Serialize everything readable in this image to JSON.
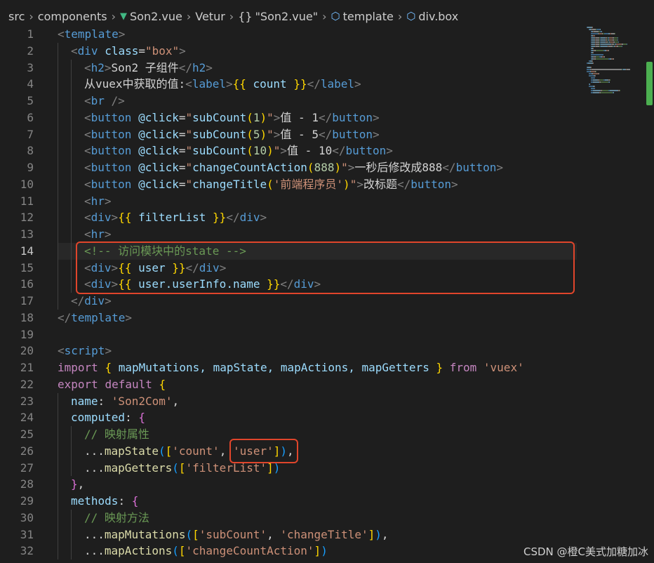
{
  "breadcrumb": {
    "items": [
      {
        "label": "src",
        "icon": ""
      },
      {
        "label": "components",
        "icon": ""
      },
      {
        "label": "Son2.vue",
        "icon": "vue-icon"
      },
      {
        "label": "Vetur",
        "icon": ""
      },
      {
        "label": "\"Son2.vue\"",
        "icon": "braces-icon"
      },
      {
        "label": "template",
        "icon": "cube-icon"
      },
      {
        "label": "div.box",
        "icon": "cube-icon"
      }
    ]
  },
  "editor": {
    "active_line": 14,
    "lines": [
      {
        "n": "1",
        "indent": 0,
        "tokens": [
          [
            "<",
            "t-punc"
          ],
          [
            "template",
            "t-tag"
          ],
          [
            ">",
            "t-punc"
          ]
        ]
      },
      {
        "n": "2",
        "indent": 1,
        "tokens": [
          [
            "<",
            "t-punc"
          ],
          [
            "div",
            "t-tag"
          ],
          [
            " ",
            "t-text"
          ],
          [
            "class",
            "t-attr"
          ],
          [
            "=",
            "t-text"
          ],
          [
            "\"box\"",
            "t-str"
          ],
          [
            ">",
            "t-punc"
          ]
        ]
      },
      {
        "n": "3",
        "indent": 2,
        "tokens": [
          [
            "<",
            "t-punc"
          ],
          [
            "h2",
            "t-tag"
          ],
          [
            ">",
            "t-punc"
          ],
          [
            "Son2 子组件",
            "t-text"
          ],
          [
            "</",
            "t-punc"
          ],
          [
            "h2",
            "t-tag"
          ],
          [
            ">",
            "t-punc"
          ]
        ]
      },
      {
        "n": "4",
        "indent": 2,
        "tokens": [
          [
            "从vuex中获取的值:",
            "t-text"
          ],
          [
            "<",
            "t-punc"
          ],
          [
            "label",
            "t-tag"
          ],
          [
            ">",
            "t-punc"
          ],
          [
            "{{",
            "t-brace"
          ],
          [
            " count ",
            "t-var"
          ],
          [
            "}}",
            "t-brace"
          ],
          [
            "</",
            "t-punc"
          ],
          [
            "label",
            "t-tag"
          ],
          [
            ">",
            "t-punc"
          ]
        ]
      },
      {
        "n": "5",
        "indent": 2,
        "tokens": [
          [
            "<",
            "t-punc"
          ],
          [
            "br",
            "t-tag"
          ],
          [
            " />",
            "t-punc"
          ]
        ]
      },
      {
        "n": "6",
        "indent": 2,
        "tokens": [
          [
            "<",
            "t-punc"
          ],
          [
            "button",
            "t-tag"
          ],
          [
            " ",
            "t-text"
          ],
          [
            "@click",
            "t-attr"
          ],
          [
            "=",
            "t-text"
          ],
          [
            "\"",
            "t-str"
          ],
          [
            "subCount",
            "t-var"
          ],
          [
            "(",
            "t-brace"
          ],
          [
            "1",
            "t-num"
          ],
          [
            ")",
            "t-brace"
          ],
          [
            "\"",
            "t-str"
          ],
          [
            ">",
            "t-punc"
          ],
          [
            "值 - 1",
            "t-text"
          ],
          [
            "</",
            "t-punc"
          ],
          [
            "button",
            "t-tag"
          ],
          [
            ">",
            "t-punc"
          ]
        ]
      },
      {
        "n": "7",
        "indent": 2,
        "tokens": [
          [
            "<",
            "t-punc"
          ],
          [
            "button",
            "t-tag"
          ],
          [
            " ",
            "t-text"
          ],
          [
            "@click",
            "t-attr"
          ],
          [
            "=",
            "t-text"
          ],
          [
            "\"",
            "t-str"
          ],
          [
            "subCount",
            "t-var"
          ],
          [
            "(",
            "t-brace"
          ],
          [
            "5",
            "t-num"
          ],
          [
            ")",
            "t-brace"
          ],
          [
            "\"",
            "t-str"
          ],
          [
            ">",
            "t-punc"
          ],
          [
            "值 - 5",
            "t-text"
          ],
          [
            "</",
            "t-punc"
          ],
          [
            "button",
            "t-tag"
          ],
          [
            ">",
            "t-punc"
          ]
        ]
      },
      {
        "n": "8",
        "indent": 2,
        "tokens": [
          [
            "<",
            "t-punc"
          ],
          [
            "button",
            "t-tag"
          ],
          [
            " ",
            "t-text"
          ],
          [
            "@click",
            "t-attr"
          ],
          [
            "=",
            "t-text"
          ],
          [
            "\"",
            "t-str"
          ],
          [
            "subCount",
            "t-var"
          ],
          [
            "(",
            "t-brace"
          ],
          [
            "10",
            "t-num"
          ],
          [
            ")",
            "t-brace"
          ],
          [
            "\"",
            "t-str"
          ],
          [
            ">",
            "t-punc"
          ],
          [
            "值 - 10",
            "t-text"
          ],
          [
            "</",
            "t-punc"
          ],
          [
            "button",
            "t-tag"
          ],
          [
            ">",
            "t-punc"
          ]
        ]
      },
      {
        "n": "9",
        "indent": 2,
        "tokens": [
          [
            "<",
            "t-punc"
          ],
          [
            "button",
            "t-tag"
          ],
          [
            " ",
            "t-text"
          ],
          [
            "@click",
            "t-attr"
          ],
          [
            "=",
            "t-text"
          ],
          [
            "\"",
            "t-str"
          ],
          [
            "changeCountAction",
            "t-var"
          ],
          [
            "(",
            "t-brace"
          ],
          [
            "888",
            "t-num"
          ],
          [
            ")",
            "t-brace"
          ],
          [
            "\"",
            "t-str"
          ],
          [
            ">",
            "t-punc"
          ],
          [
            "一秒后修改成888",
            "t-text"
          ],
          [
            "</",
            "t-punc"
          ],
          [
            "button",
            "t-tag"
          ],
          [
            ">",
            "t-punc"
          ]
        ]
      },
      {
        "n": "10",
        "indent": 2,
        "tokens": [
          [
            "<",
            "t-punc"
          ],
          [
            "button",
            "t-tag"
          ],
          [
            " ",
            "t-text"
          ],
          [
            "@click",
            "t-attr"
          ],
          [
            "=",
            "t-text"
          ],
          [
            "\"",
            "t-str"
          ],
          [
            "changeTitle",
            "t-var"
          ],
          [
            "(",
            "t-brace"
          ],
          [
            "'前端程序员'",
            "t-str"
          ],
          [
            ")",
            "t-brace"
          ],
          [
            "\"",
            "t-str"
          ],
          [
            ">",
            "t-punc"
          ],
          [
            "改标题",
            "t-text"
          ],
          [
            "</",
            "t-punc"
          ],
          [
            "button",
            "t-tag"
          ],
          [
            ">",
            "t-punc"
          ]
        ]
      },
      {
        "n": "11",
        "indent": 2,
        "tokens": [
          [
            "<",
            "t-punc"
          ],
          [
            "hr",
            "t-tag"
          ],
          [
            ">",
            "t-punc"
          ]
        ]
      },
      {
        "n": "12",
        "indent": 2,
        "tokens": [
          [
            "<",
            "t-punc"
          ],
          [
            "div",
            "t-tag"
          ],
          [
            ">",
            "t-punc"
          ],
          [
            "{{",
            "t-brace"
          ],
          [
            " filterList ",
            "t-var"
          ],
          [
            "}}",
            "t-brace"
          ],
          [
            "</",
            "t-punc"
          ],
          [
            "div",
            "t-tag"
          ],
          [
            ">",
            "t-punc"
          ]
        ]
      },
      {
        "n": "13",
        "indent": 2,
        "tokens": [
          [
            "<",
            "t-punc"
          ],
          [
            "hr",
            "t-tag"
          ],
          [
            ">",
            "t-punc"
          ]
        ]
      },
      {
        "n": "14",
        "indent": 2,
        "tokens": [
          [
            "<!-- 访问模块中的state -->",
            "t-cmt-html"
          ]
        ]
      },
      {
        "n": "15",
        "indent": 2,
        "tokens": [
          [
            "<",
            "t-punc"
          ],
          [
            "div",
            "t-tag"
          ],
          [
            ">",
            "t-punc"
          ],
          [
            "{{",
            "t-brace"
          ],
          [
            " user ",
            "t-var"
          ],
          [
            "}}",
            "t-brace"
          ],
          [
            "</",
            "t-punc"
          ],
          [
            "div",
            "t-tag"
          ],
          [
            ">",
            "t-punc"
          ]
        ]
      },
      {
        "n": "16",
        "indent": 2,
        "tokens": [
          [
            "<",
            "t-punc"
          ],
          [
            "div",
            "t-tag"
          ],
          [
            ">",
            "t-punc"
          ],
          [
            "{{",
            "t-brace"
          ],
          [
            " user.userInfo.name ",
            "t-var"
          ],
          [
            "}}",
            "t-brace"
          ],
          [
            "</",
            "t-punc"
          ],
          [
            "div",
            "t-tag"
          ],
          [
            ">",
            "t-punc"
          ]
        ]
      },
      {
        "n": "17",
        "indent": 1,
        "tokens": [
          [
            "</",
            "t-punc"
          ],
          [
            "div",
            "t-tag"
          ],
          [
            ">",
            "t-punc"
          ]
        ]
      },
      {
        "n": "18",
        "indent": 0,
        "tokens": [
          [
            "</",
            "t-punc"
          ],
          [
            "template",
            "t-tag"
          ],
          [
            ">",
            "t-punc"
          ]
        ]
      },
      {
        "n": "19",
        "indent": 0,
        "tokens": []
      },
      {
        "n": "20",
        "indent": 0,
        "tokens": [
          [
            "<",
            "t-punc"
          ],
          [
            "script",
            "t-tag"
          ],
          [
            ">",
            "t-punc"
          ]
        ]
      },
      {
        "n": "21",
        "indent": 0,
        "tokens": [
          [
            "import",
            "t-kw"
          ],
          [
            " ",
            "t-text"
          ],
          [
            "{",
            "t-brace"
          ],
          [
            " mapMutations, mapState, mapActions, mapGetters ",
            "t-var"
          ],
          [
            "}",
            "t-brace"
          ],
          [
            " ",
            "t-text"
          ],
          [
            "from",
            "t-kw"
          ],
          [
            " ",
            "t-text"
          ],
          [
            "'vuex'",
            "t-str"
          ]
        ]
      },
      {
        "n": "22",
        "indent": 0,
        "tokens": [
          [
            "export",
            "t-kw"
          ],
          [
            " ",
            "t-text"
          ],
          [
            "default",
            "t-kw"
          ],
          [
            " ",
            "t-text"
          ],
          [
            "{",
            "t-brace"
          ]
        ]
      },
      {
        "n": "23",
        "indent": 1,
        "tokens": [
          [
            "name",
            "t-var"
          ],
          [
            ": ",
            "t-text"
          ],
          [
            "'Son2Com'",
            "t-str"
          ],
          [
            ",",
            "t-text"
          ]
        ]
      },
      {
        "n": "24",
        "indent": 1,
        "tokens": [
          [
            "computed",
            "t-var"
          ],
          [
            ": ",
            "t-text"
          ],
          [
            "{",
            "t-paren1"
          ]
        ]
      },
      {
        "n": "25",
        "indent": 2,
        "tokens": [
          [
            "// 映射属性",
            "t-cmt"
          ]
        ]
      },
      {
        "n": "26",
        "indent": 2,
        "tokens": [
          [
            "...",
            "t-text"
          ],
          [
            "mapState",
            "t-fn"
          ],
          [
            "(",
            "t-paren2"
          ],
          [
            "[",
            "t-brace"
          ],
          [
            "'count'",
            "t-str"
          ],
          [
            ", ",
            "t-text"
          ],
          [
            "'user'",
            "t-str"
          ],
          [
            "]",
            "t-brace"
          ],
          [
            ")",
            "t-paren2"
          ],
          [
            ",",
            "t-text"
          ]
        ]
      },
      {
        "n": "27",
        "indent": 2,
        "tokens": [
          [
            "...",
            "t-text"
          ],
          [
            "mapGetters",
            "t-fn"
          ],
          [
            "(",
            "t-paren2"
          ],
          [
            "[",
            "t-brace"
          ],
          [
            "'filterList'",
            "t-str"
          ],
          [
            "]",
            "t-brace"
          ],
          [
            ")",
            "t-paren2"
          ]
        ]
      },
      {
        "n": "28",
        "indent": 1,
        "tokens": [
          [
            "}",
            "t-paren1"
          ],
          [
            ",",
            "t-text"
          ]
        ]
      },
      {
        "n": "29",
        "indent": 1,
        "tokens": [
          [
            "methods",
            "t-var"
          ],
          [
            ": ",
            "t-text"
          ],
          [
            "{",
            "t-paren1"
          ]
        ]
      },
      {
        "n": "30",
        "indent": 2,
        "tokens": [
          [
            "// 映射方法",
            "t-cmt"
          ]
        ]
      },
      {
        "n": "31",
        "indent": 2,
        "tokens": [
          [
            "...",
            "t-text"
          ],
          [
            "mapMutations",
            "t-fn"
          ],
          [
            "(",
            "t-paren2"
          ],
          [
            "[",
            "t-brace"
          ],
          [
            "'subCount'",
            "t-str"
          ],
          [
            ", ",
            "t-text"
          ],
          [
            "'changeTitle'",
            "t-str"
          ],
          [
            "]",
            "t-brace"
          ],
          [
            ")",
            "t-paren2"
          ],
          [
            ",",
            "t-text"
          ]
        ]
      },
      {
        "n": "32",
        "indent": 2,
        "tokens": [
          [
            "...",
            "t-text"
          ],
          [
            "mapActions",
            "t-fn"
          ],
          [
            "(",
            "t-paren2"
          ],
          [
            "[",
            "t-brace"
          ],
          [
            "'changeCountAction'",
            "t-str"
          ],
          [
            "]",
            "t-brace"
          ],
          [
            ")",
            "t-paren2"
          ]
        ]
      }
    ]
  },
  "colors": {
    "highlight_box": "#e0452b",
    "scroll_thumb": "#4caf50"
  },
  "watermark": "CSDN @橙C美式加糖加冰"
}
